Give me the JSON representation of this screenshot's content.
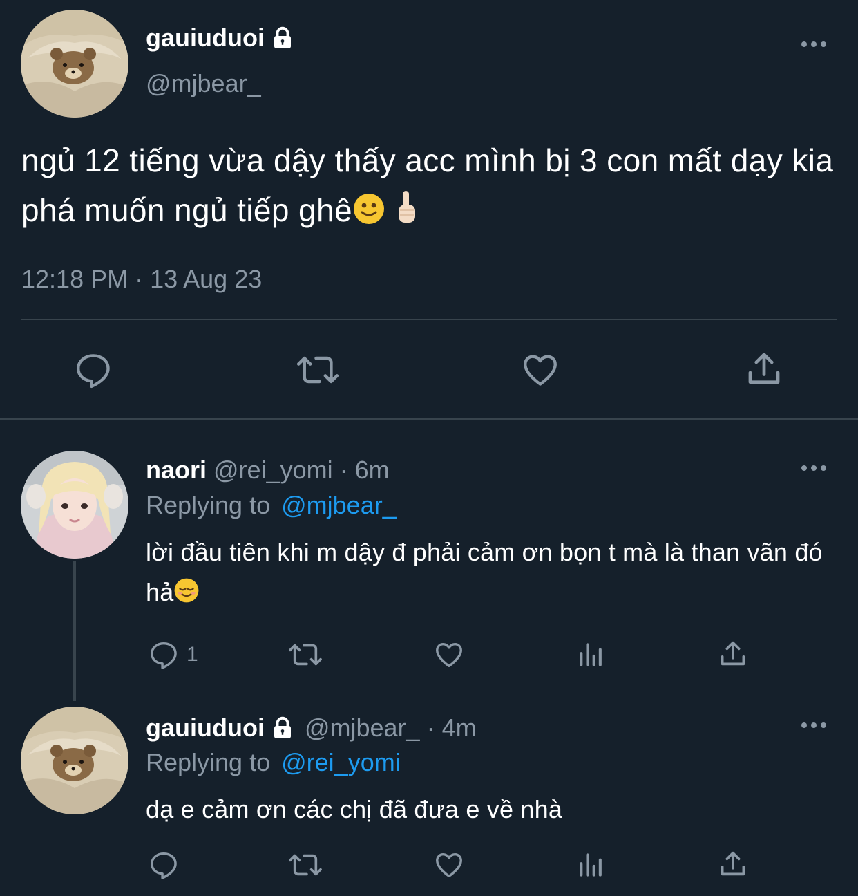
{
  "main_tweet": {
    "author": {
      "display_name": "gauiuduoi",
      "handle": "@mjbear_",
      "avatar_icon": "teddy-bear-in-blanket-avatar",
      "protected_icon": "lock-icon"
    },
    "text": "ngủ 12 tiếng vừa dậy thấy acc mình bị 3 con mất dạy kia phá muốn ngủ tiếp ghê",
    "emojis": [
      "🙂",
      "☝️"
    ],
    "timestamp": "12:18 PM · 13 Aug 23",
    "actions": [
      {
        "name": "reply",
        "icon": "reply-icon"
      },
      {
        "name": "retweet",
        "icon": "retweet-icon"
      },
      {
        "name": "like",
        "icon": "heart-icon"
      },
      {
        "name": "share",
        "icon": "share-icon"
      }
    ]
  },
  "replies": [
    {
      "display_name": "naori",
      "handle": "@rei_yomi",
      "time": "· 6m",
      "replying_label": "Replying to",
      "replying_to": "@mjbear_",
      "text": "lời đầu tiên khi m dậy đ phải cảm ơn bọn t mà là than vãn đó hả",
      "emoji": "😌",
      "reply_count": "1",
      "avatar_icon": "blonde-girl-avatar"
    },
    {
      "display_name": "gauiuduoi",
      "handle": "@mjbear_",
      "time": "· 4m",
      "replying_label": "Replying to",
      "replying_to": "@rei_yomi",
      "text": "dạ e cảm ơn các chị đã đưa e về nhà",
      "reply_count": "",
      "avatar_icon": "teddy-bear-in-blanket-avatar"
    }
  ],
  "colors": {
    "background": "#15202b",
    "text": "#ffffff",
    "muted": "#8b98a5",
    "link": "#1d9bf0",
    "divider": "#38444d"
  }
}
